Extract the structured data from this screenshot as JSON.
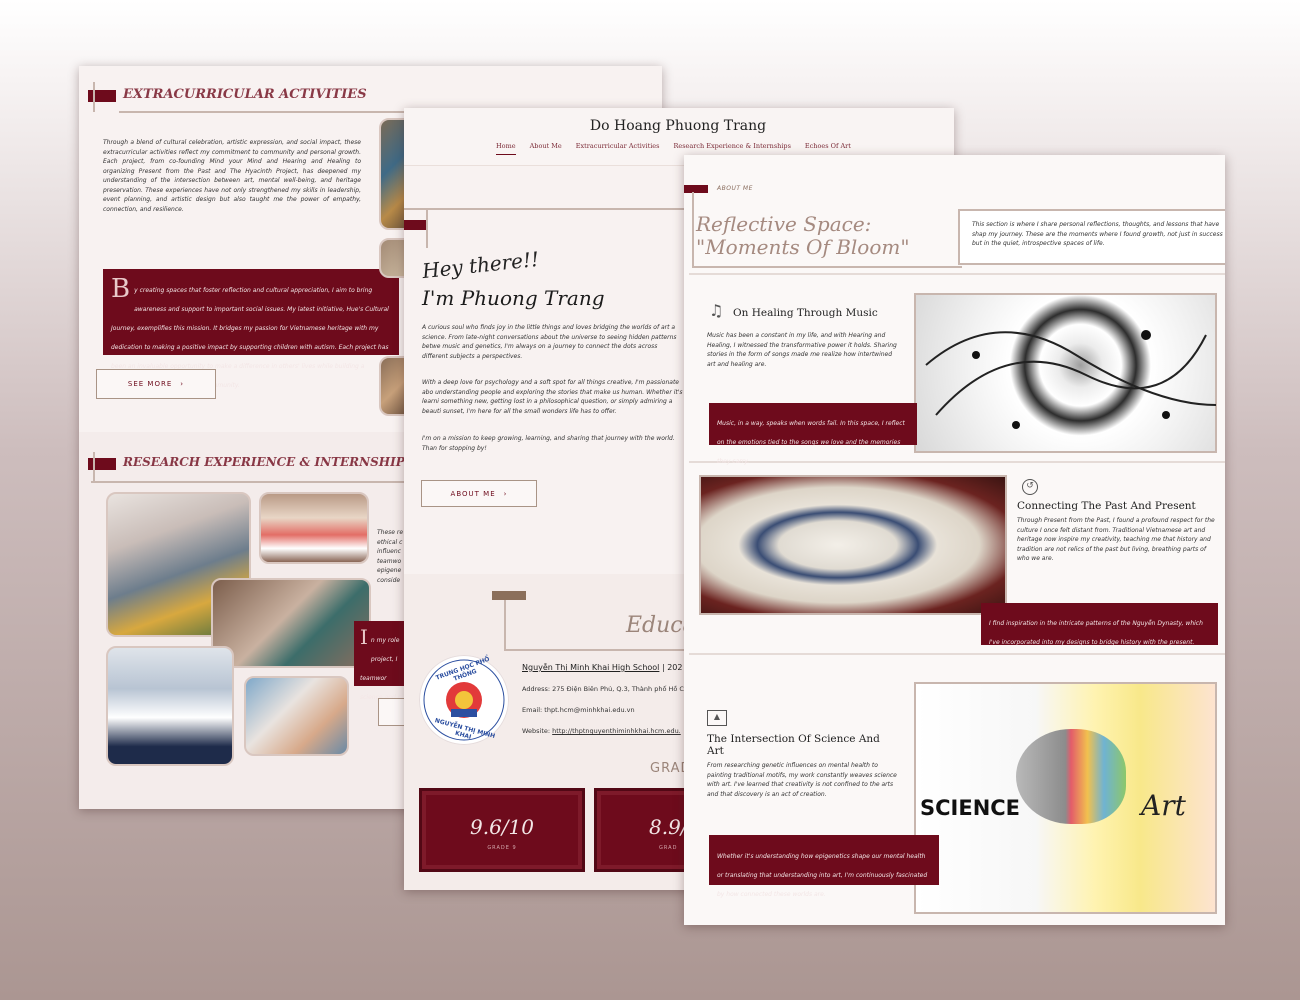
{
  "left_panel": {
    "section1_title": "EXTRACURRICULAR ACTIVITIES",
    "section1_text": "Through a blend of cultural celebration, artistic expression, and social impact, these extracurricular activities reflect my commitment to community and personal growth. Each project, from co-founding Mind your Mind and Hearing and Healing to organizing Present from the Past and The Hyacinth Project, has deepened my understanding of the intersection between art, mental well-being, and heritage preservation. These experiences have not only strengthened my skills in leadership, event planning, and artistic design but also taught me the power of empathy, connection, and resilience.",
    "quote_initial": "B",
    "quote_text": "y creating spaces that foster reflection and cultural appreciation, I aim to bring awareness and support to important social issues. My latest initiative, Hue's Cultural Journey, exemplifies this mission. It bridges my passion for Vietnamese heritage with my dedication to making a positive impact by supporting children with autism. Each project has been an invaluable opportunity to make a difference in others' lives while building a stronger, more compassionate community.",
    "see_more_label": "SEE MORE",
    "section2_title": "RESEARCH EXPERIENCE & INTERNSHIPS",
    "section2_text": "These re ethical c influenc teamwo epigene conside",
    "quote2_initial": "I",
    "quote2_text": "n my role project, I teamwor science and c"
  },
  "middle_panel": {
    "site_title": "Do Hoang Phuong Trang",
    "nav": [
      "Home",
      "About Me",
      "Extracurricular Activities",
      "Research Experience & Internships",
      "Echoes Of Art"
    ],
    "greeting": "Hey there!!",
    "name": "I'm Phuong Trang",
    "para1": "A curious soul who finds joy in the little things and loves bridging the worlds of art a science. From late-night conversations about the universe to seeing hidden patterns betwe music and genetics, I'm always on a journey to connect the dots across different subjects a perspectives.",
    "para2": "With a deep love for psychology and a soft spot for all things creative, I'm passionate abo understanding people and exploring the stories that make us human. Whether it's learni something new, getting lost in a philosophical question, or simply admiring a beauti sunset, I'm here for all the small wonders life has to offer.",
    "para3": "I'm on a mission to keep growing, learning, and sharing that journey with the world. Than for stopping by!",
    "about_btn": "ABOUT ME",
    "edu_title": "Educa",
    "school_name": "Nguyễn Thị Minh Khai High School",
    "school_suffix": " | 202",
    "address": "Address: 275 Điện Biên Phủ, Q.3, Thành phố Hồ C",
    "email": "Email: thpt.hcm@minhkhai.edu.vn",
    "website_label": "Website: ",
    "website": "http://thptnguyenthiminhkhai.hcm.edu.",
    "logo_text_top": "TRUNG HỌC PHỔ THÔNG",
    "logo_text_bottom": "NGUYỄN THỊ MINH KHAI",
    "grad_label": "GRAD",
    "grade1_value": "9.6/10",
    "grade1_label": "GRADE 9",
    "grade2_value": "8.9/",
    "grade2_label": "GRAD"
  },
  "right_panel": {
    "eyebrow": "ABOUT ME",
    "title_line1": "Reflective Space:",
    "title_line2": "\"Moments Of Bloom\"",
    "intro": "This section is where I share personal reflections, thoughts, and lessons that have shap my journey. These are the moments where I found growth, not just in success but in the quiet, introspective spaces of life.",
    "card1_title": "On Healing Through Music",
    "card1_text": "Music has been a constant in my life, and with Hearing and Healing, I witnessed the transformative power it holds. Sharing stories in the form of songs made me realize how intertwined art and healing are.",
    "card1_quote": "Music, in a way, speaks when words fail. In this space, I reflect on the emotions tied to the songs we love and the memories they carry.",
    "card2_title": "Connecting The Past And Present",
    "card2_text": "Through Present from the Past, I found a profound respect for the culture I once felt distant from. Traditional Vietnamese art and heritage now inspire my creativity, teaching me that history and tradition are not relics of the past but living, breathing parts of who we are.",
    "card2_quote": "I find inspiration in the intricate patterns of the Nguyễn Dynasty, which I've incorporated into my designs to bridge history with the present.",
    "card3_title": "The Intersection Of Science And Art",
    "card3_text": "From researching genetic influences on mental health to painting traditional motifs, my work constantly weaves science with art. I've learned that creativity is not confined to the arts and that discovery is an act of creation.",
    "card3_quote": "Whether it's understanding how epigenetics shape our mental health or translating that understanding into art, I'm continuously fascinated by how connected these worlds are.",
    "science_word": "SCIENCE",
    "art_word": "Art"
  }
}
